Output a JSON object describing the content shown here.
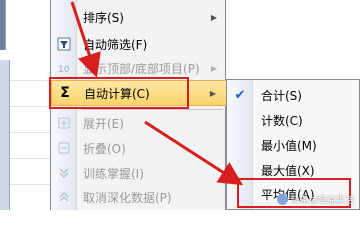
{
  "main_menu": {
    "items": [
      {
        "label": "排序(S)",
        "icon": "sort-icon",
        "disabled": false,
        "has_submenu": true
      },
      {
        "label": "自动筛选(F)",
        "icon": "autofilter-icon",
        "disabled": false,
        "has_submenu": false
      },
      {
        "label": "显示顶部/底部项目(P)",
        "icon": "top-bottom-icon",
        "disabled": true,
        "has_submenu": true
      },
      {
        "label": "自动计算(C)",
        "icon": "sigma-icon",
        "disabled": false,
        "has_submenu": true,
        "highlighted": true
      },
      {
        "label": "展开(E)",
        "icon": "expand-icon",
        "disabled": true,
        "has_submenu": false
      },
      {
        "label": "折叠(O)",
        "icon": "collapse-icon",
        "disabled": true,
        "has_submenu": false
      },
      {
        "label": "训练掌握(I)",
        "icon": "drill-icon",
        "disabled": true,
        "has_submenu": false
      },
      {
        "label": "取消深化数据(P)",
        "icon": "undrill-icon",
        "disabled": true,
        "has_submenu": false
      }
    ]
  },
  "sub_menu": {
    "items": [
      {
        "label": "合计(S)",
        "checked": true
      },
      {
        "label": "计数(C)",
        "checked": false
      },
      {
        "label": "最小值(M)",
        "checked": false
      },
      {
        "label": "最大值(X)",
        "checked": false
      },
      {
        "label": "平均值(A)",
        "checked": false,
        "highlighted": true
      }
    ]
  },
  "icons": {
    "sigma": "Σ",
    "check": "✔",
    "submenu_arrow": "▶"
  },
  "annotation_color": "#d81e1e",
  "watermark": {
    "text": "头条@每益生活"
  }
}
